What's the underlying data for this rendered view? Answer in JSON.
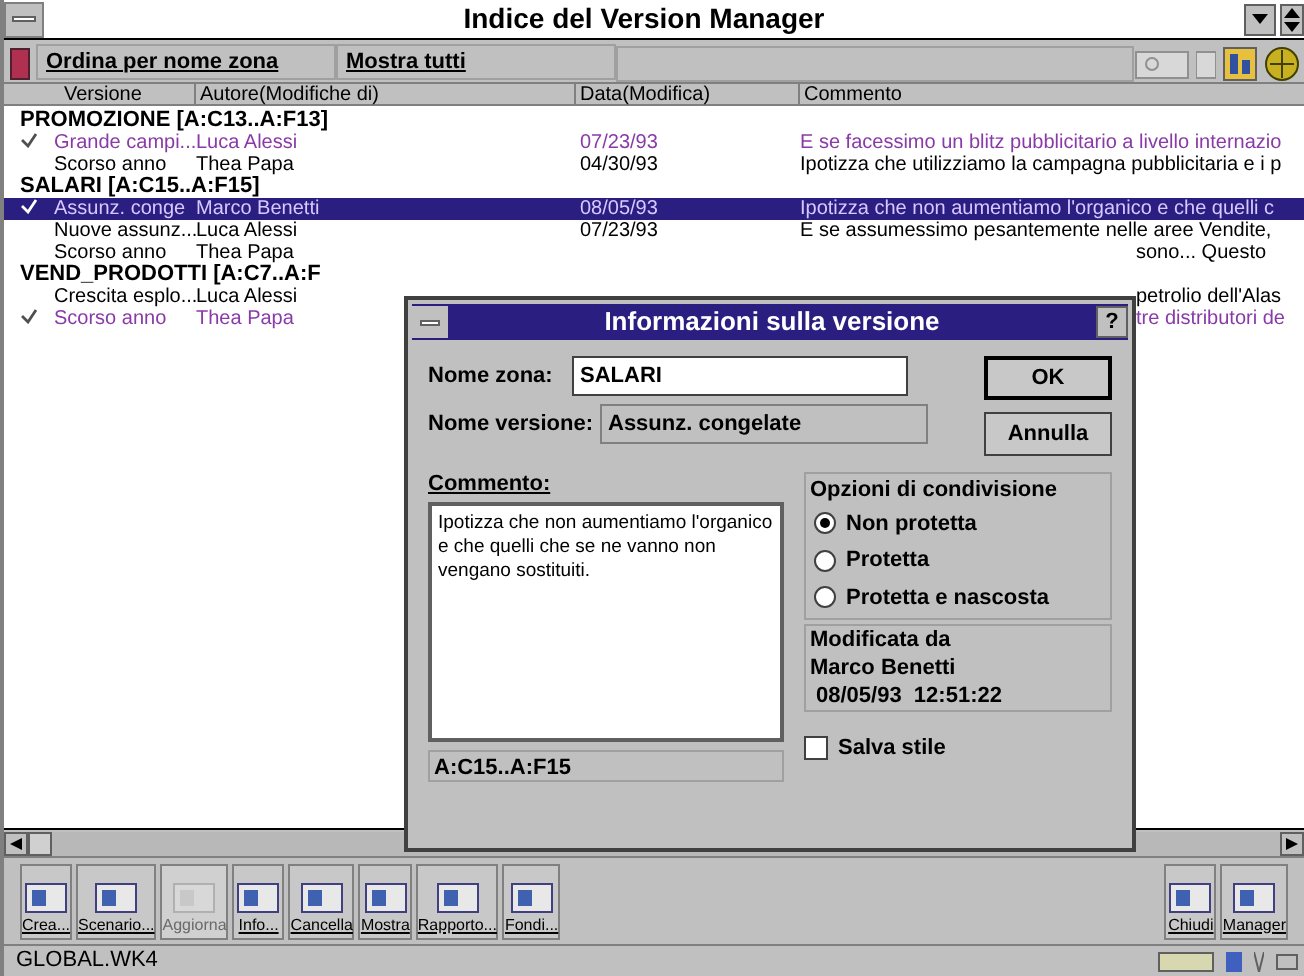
{
  "window": {
    "title": "Indice del Version Manager"
  },
  "toolbar": {
    "buttons": [
      "Ordina per nome zona",
      "Mostra tutti"
    ]
  },
  "columns": [
    "Versione",
    "Autore(Modifiche di)",
    "Data(Modifica)",
    "Commento"
  ],
  "groups": [
    {
      "name": "PROMOZIONE [A:C13..A:F13]",
      "versions": [
        {
          "version": "Grande campi...",
          "author": "Luca Alessi",
          "date": "07/23/93",
          "comment": "E se facessimo un blitz pubblicitario a livello internazio",
          "checked": true,
          "selected": false
        },
        {
          "version": "Scorso anno",
          "author": "Thea Papa",
          "date": "04/30/93",
          "comment": "Ipotizza che utilizziamo la campagna pubblicitaria e i p",
          "checked": false,
          "selected": false
        }
      ]
    },
    {
      "name": "SALARI [A:C15..A:F15]",
      "versions": [
        {
          "version": "Assunz. conge",
          "author": "Marco Benetti",
          "date": "08/05/93",
          "comment": "Ipotizza che non aumentiamo l'organico e che quelli c",
          "checked": true,
          "selected": true
        },
        {
          "version": "Nuove assunz...",
          "author": "Luca Alessi",
          "date": "07/23/93",
          "comment": "E se assumessimo pesantemente nelle aree Vendite,",
          "checked": false,
          "selected": false
        },
        {
          "version": "Scorso anno",
          "author": "Thea Papa",
          "comment": "sono... Questo",
          "checked": false,
          "selected": false
        }
      ]
    },
    {
      "name": "VEND_PRODOTTI [A:C7..A:F",
      "versions": [
        {
          "version": "Crescita esplo...",
          "author": "Luca Alessi",
          "comment": "petrolio dell'Alas",
          "checked": false,
          "selected": false
        },
        {
          "version": "Scorso anno",
          "author": "Thea Papa",
          "comment": "tre distributori de",
          "checked": true,
          "selected": false
        }
      ]
    }
  ],
  "dialog": {
    "title": "Informazioni sulla versione",
    "help": "?",
    "zone_label": "Nome zona:",
    "zone_value": "SALARI",
    "version_label": "Nome versione:",
    "version_value": "Assunz. congelate",
    "buttons": [
      "OK",
      "Annulla"
    ],
    "comment_label": "Commento:",
    "comment": "Ipotizza che non aumentiamo l'organico e che quelli che se ne vanno non vengano sostituiti.",
    "sharing": {
      "title": "Opzioni di condivisione",
      "options": [
        {
          "label": "Non protetta",
          "selected": true
        },
        {
          "label": "Protetta",
          "selected": false
        },
        {
          "label": "Protetta e nascosta",
          "selected": false
        }
      ]
    },
    "modified": {
      "title": "Modificata da",
      "author": "Marco Benetti",
      "timestamp": "08/05/93  12:51:22"
    },
    "range": "A:C15..A:F15",
    "save_style": {
      "label": "Salva stile",
      "checked": false
    }
  },
  "bottom_toolbar": [
    {
      "label": "Crea...",
      "disabled": false
    },
    {
      "label": "Scenario...",
      "disabled": false
    },
    {
      "label": "Aggiorna",
      "disabled": true
    },
    {
      "label": "Info...",
      "disabled": false
    },
    {
      "label": "Cancella",
      "disabled": false
    },
    {
      "label": "Mostra",
      "disabled": false
    },
    {
      "label": "Rapporto...",
      "disabled": false
    },
    {
      "label": "Fondi...",
      "disabled": false
    }
  ],
  "bottom_toolbar_right": [
    {
      "label": "Chiudi",
      "disabled": false
    },
    {
      "label": "Manager",
      "disabled": false
    }
  ],
  "status_bar": {
    "file": "GLOBAL.WK4"
  }
}
